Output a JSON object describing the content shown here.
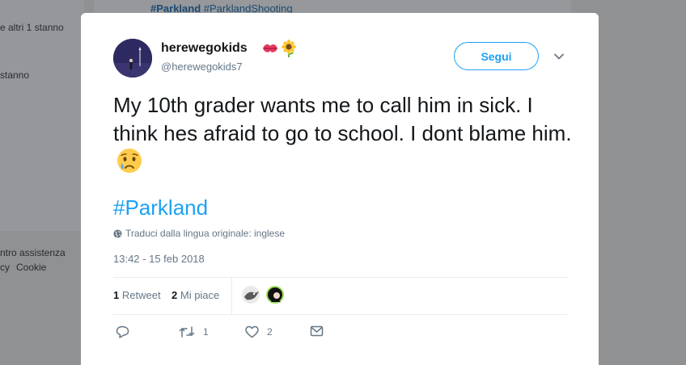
{
  "background": {
    "left_texts": [
      "e altri 1 stanno",
      "stanno",
      "ntro assistenza",
      "cy",
      "Cookie"
    ],
    "top_hashtags": [
      "#Parkland",
      "#ParklandShooting"
    ]
  },
  "tweet": {
    "user": {
      "name": "herewegokids",
      "handle": "@herewegokids7",
      "name_emojis": [
        "kiss-mark",
        "sunflower"
      ]
    },
    "follow_label": "Segui",
    "text": "My 10th grader wants me to call him in sick. I think hes afraid to go to school. I dont blame him.",
    "text_emoji": "crying-face",
    "hashtag": "#Parkland",
    "translate_label": "Traduci dalla lingua originale: inglese",
    "timestamp": "13:42 - 15 feb 2018",
    "stats": {
      "retweets_count": "1",
      "retweets_label": "Retweet",
      "likes_count": "2",
      "likes_label": "Mi piace"
    },
    "actions": {
      "reply_count": "",
      "retweet_count": "1",
      "like_count": "2"
    }
  },
  "colors": {
    "accent": "#1da1f2",
    "secondary_text": "#657786",
    "overlay": "#8f9193"
  }
}
